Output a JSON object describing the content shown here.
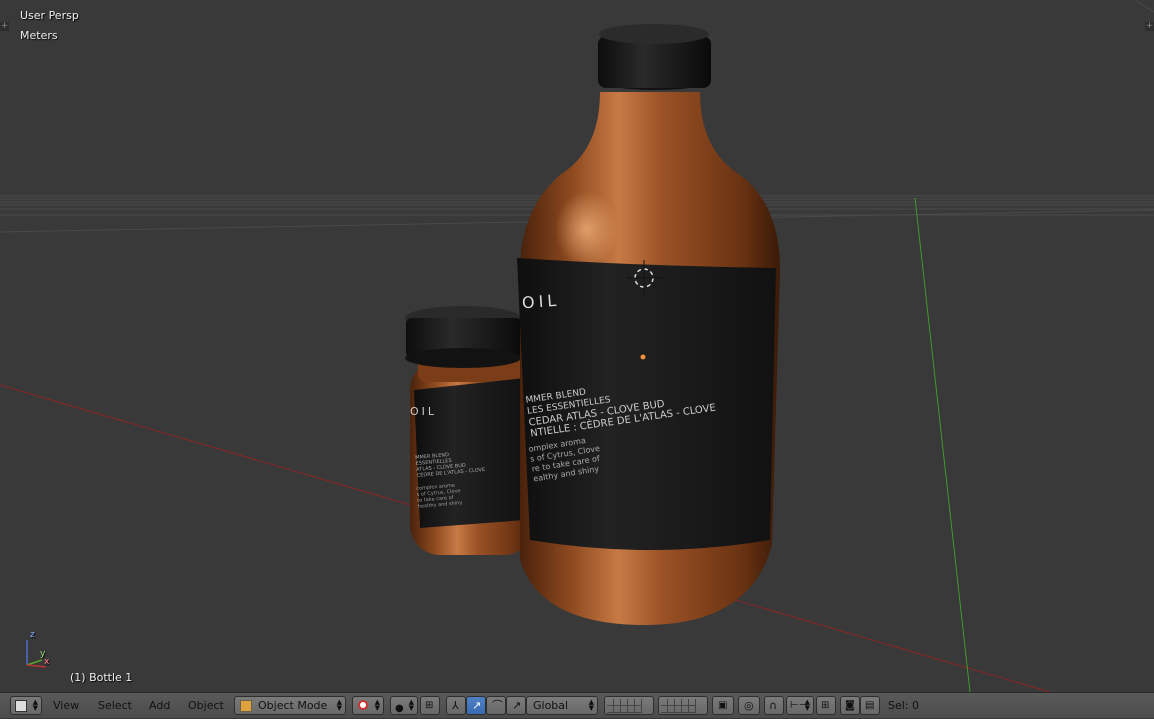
{
  "viewport": {
    "view_name": "User Persp",
    "units": "Meters",
    "selected_object_label": "(1) Bottle 1",
    "label": {
      "big_title": "OIL",
      "big_lines": [
        "MMER BLEND",
        "LES ESSENTIELLES",
        "CEDAR ATLAS - CLOVE BUD",
        "NTIELLE : CÈDRE DE L'ATLAS - CLOVE"
      ],
      "big_lines_2": [
        "omplex aroma",
        "s of Cytrus, Clove",
        "re to take care of",
        "ealthy and shiny"
      ],
      "small_title": "OIL",
      "small_lines": [
        "MMER BLEND",
        "ESSENTIELLES",
        "ATLAS - CLOVE BUD",
        "CÈDRE DE L'ATLAS - CLOVE"
      ],
      "small_lines_2": [
        "complex aroma",
        "s of Cytrus, Clove",
        "to take care of",
        "healthy and shiny"
      ]
    },
    "axis_labels": {
      "x": "x",
      "y": "y",
      "z": "z"
    }
  },
  "header": {
    "menus": [
      "View",
      "Select",
      "Add",
      "Object"
    ],
    "mode": "Object Mode",
    "orientation": "Global",
    "selection_status": "Sel: 0"
  },
  "colors": {
    "viewport_bg": "#393939",
    "bottle": "#8e4a1f",
    "label": "#1a1a1a",
    "cap": "#151515",
    "x_axis": "#9a2a2a",
    "y_axis": "#4a9a2a",
    "header_bg": "#555555",
    "active_button": "#4a7bc0"
  }
}
